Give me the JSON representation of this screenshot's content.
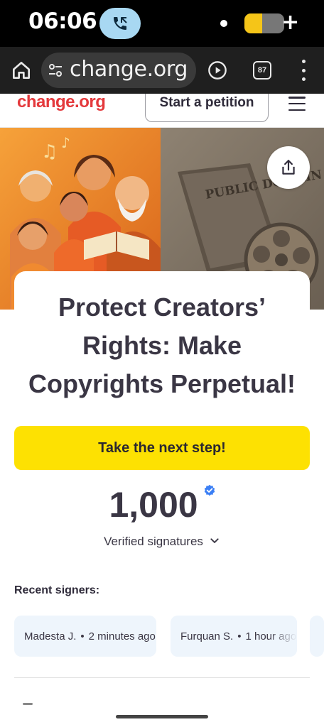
{
  "status_bar": {
    "time": "06:06",
    "call_icon": "phone-call-icon",
    "battery_level": 0.45,
    "accent_color": "#a8d8f2"
  },
  "browser": {
    "url": "change.org",
    "tab_count": "87",
    "icons": [
      "home-icon",
      "tune-icon",
      "play-circle-icon",
      "tabs-icon",
      "more-vert-icon"
    ]
  },
  "site_header": {
    "logo": "change.org",
    "start_petition_label": "Start a petition",
    "menu_icon": "hamburger-icon",
    "brand_color": "#e4393c"
  },
  "hero": {
    "image_text": "PUBLIC DOMAIN",
    "share_icon": "share-icon"
  },
  "petition": {
    "title": "Protect Creators’ Rights: Make Copyrights Perpetual!",
    "next_step_label": "Take the next step!",
    "signature_count": "1,000",
    "signature_label": "Verified signatures",
    "cta_color": "#fde102"
  },
  "recent_signers": {
    "heading": "Recent signers:",
    "items": [
      {
        "name": "Madesta J.",
        "time": "2 minutes ago"
      },
      {
        "name": "Furquan S.",
        "time": "1 hour ago"
      }
    ]
  }
}
